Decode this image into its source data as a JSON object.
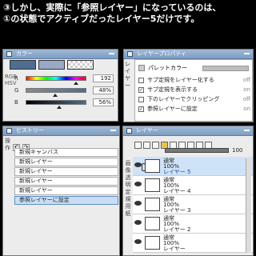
{
  "caption": {
    "line1": "③しかし、実際に「参照レイヤー」になっているのは、",
    "line2": "①の状態でアクティブだったレイヤー5だけです。"
  },
  "color_panel": {
    "title": "カラー",
    "side_labels": "RGB HSV",
    "swatches": [
      "#4f6d8f",
      "#9aa8c7",
      "checker"
    ],
    "rows": [
      {
        "label": "R",
        "value": "192"
      },
      {
        "label": "G",
        "value": "48%"
      },
      {
        "label": "B",
        "value": "56%"
      }
    ]
  },
  "layer_property": {
    "title": "レイヤープロパティ",
    "side": "レイヤー",
    "palette_label": "パレットカラー",
    "items": [
      {
        "label": "サブ定規をレイヤー化する",
        "checked": false,
        "state": "off"
      },
      {
        "label": "サブ定規を表示する",
        "checked": true,
        "state": "on"
      },
      {
        "label": "下のレイヤーでクリッピング",
        "checked": false,
        "state": "off"
      },
      {
        "label": "参照レイヤーに設定",
        "checked": true,
        "state": "on"
      }
    ]
  },
  "history": {
    "title": "ヒストリー",
    "side": "操作",
    "items": [
      "新規キャンバス",
      "新規レイヤー",
      "新規レイヤー",
      "新規レイヤー",
      "新規レイヤー",
      "参照レイヤーに設定"
    ]
  },
  "layers_panel": {
    "title": "レイヤー",
    "side": "画像 透明 定規 用紙",
    "opacity": "100",
    "layers": [
      {
        "mode": "通常",
        "opacity": "100%",
        "name": "レイヤー 5"
      },
      {
        "mode": "通常",
        "opacity": "100%",
        "name": "レイヤー 4"
      },
      {
        "mode": "通常",
        "opacity": "100%",
        "name": "レイヤー 3"
      },
      {
        "mode": "通常",
        "opacity": "100%",
        "name": "レイヤー 2"
      },
      {
        "mode": "通常",
        "opacity": "100%",
        "name": "レイヤー"
      }
    ]
  }
}
